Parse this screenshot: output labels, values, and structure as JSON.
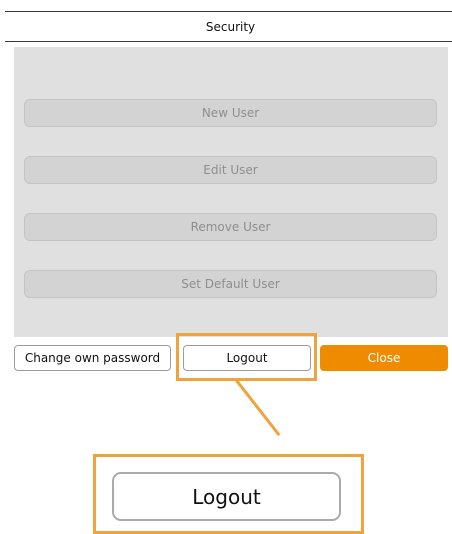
{
  "window": {
    "title": "Security"
  },
  "actions": [
    {
      "label": "New User"
    },
    {
      "label": "Edit User"
    },
    {
      "label": "Remove User"
    },
    {
      "label": "Set Default User"
    }
  ],
  "footer": {
    "change_password_label": "Change own password",
    "logout_label": "Logout",
    "close_label": "Close"
  },
  "callout": {
    "label": "Logout"
  },
  "colors": {
    "accent": "#ef8b00",
    "highlight": "#f2a23a",
    "panel_background": "#e0e0e0"
  }
}
